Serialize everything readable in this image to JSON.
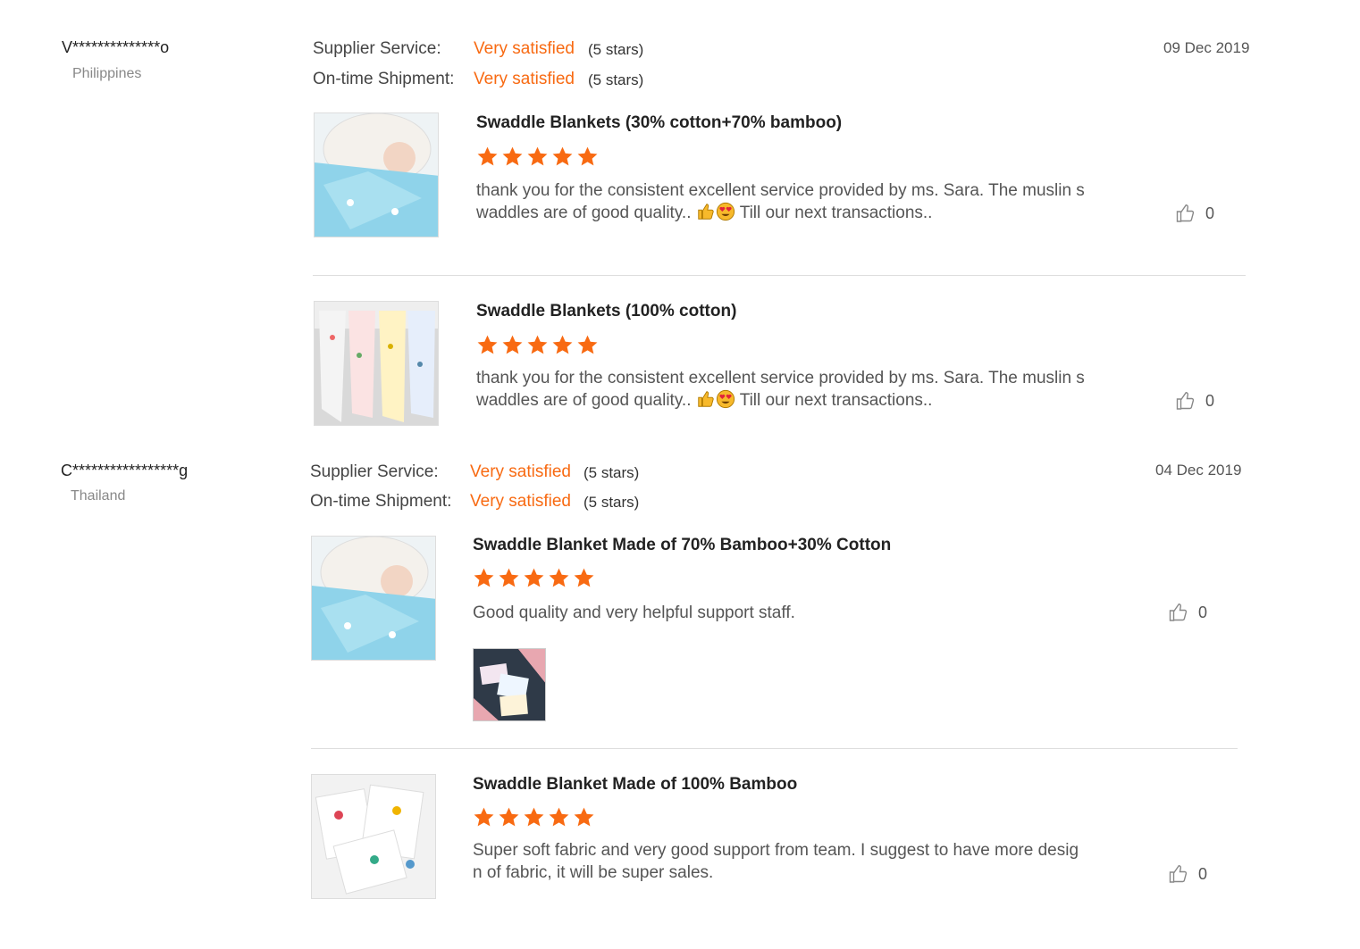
{
  "reviews": [
    {
      "buyer": "V**************o",
      "country": "Philippines",
      "date": "09 Dec 2019",
      "supplier_service_label": "Supplier Service:",
      "supplier_service_value": "Very satisfied",
      "supplier_service_stars": "(5 stars)",
      "shipment_label": "On-time Shipment:",
      "shipment_value": "Very satisfied",
      "shipment_stars": "(5 stars)",
      "products": [
        {
          "title": "Swaddle Blankets (30% cotton+70% bamboo)",
          "rating": 5,
          "text_line1": "thank you for the consistent excellent service provided by ms. Sara. The muslin s",
          "text_line2_a": "waddles are of good quality..",
          "text_line2_b": "Till our next transactions..",
          "likes": "0"
        },
        {
          "title": "Swaddle Blankets (100% cotton)",
          "rating": 5,
          "text_line1": "thank you for the consistent excellent service provided by ms. Sara. The muslin s",
          "text_line2_a": "waddles are of good quality..",
          "text_line2_b": "Till our next transactions..",
          "likes": "0"
        }
      ]
    },
    {
      "buyer": "C*****************g",
      "country": "Thailand",
      "date": "04 Dec 2019",
      "supplier_service_label": "Supplier Service:",
      "supplier_service_value": "Very satisfied",
      "supplier_service_stars": "(5 stars)",
      "shipment_label": "On-time Shipment:",
      "shipment_value": "Very satisfied",
      "shipment_stars": "(5 stars)",
      "products": [
        {
          "title": "Swaddle Blanket Made of 70% Bamboo+30% Cotton",
          "rating": 5,
          "text_line1": "Good quality and very helpful support staff.",
          "likes": "0"
        },
        {
          "title": "Swaddle Blanket Made of 100% Bamboo",
          "rating": 5,
          "text_line1": "Super soft fabric and very good support from team. I suggest to have more desig",
          "text_line2": "n of fabric, it will be super sales.",
          "likes": "0"
        }
      ]
    }
  ],
  "colors": {
    "accent": "#f86a12",
    "star": "#f86a12",
    "divider": "#dddddd"
  },
  "icons": {
    "star": "star-icon",
    "like": "thumbs-up-icon",
    "emoji1": "thumbs-up-emoji",
    "emoji2": "heart-eyes-emoji"
  }
}
